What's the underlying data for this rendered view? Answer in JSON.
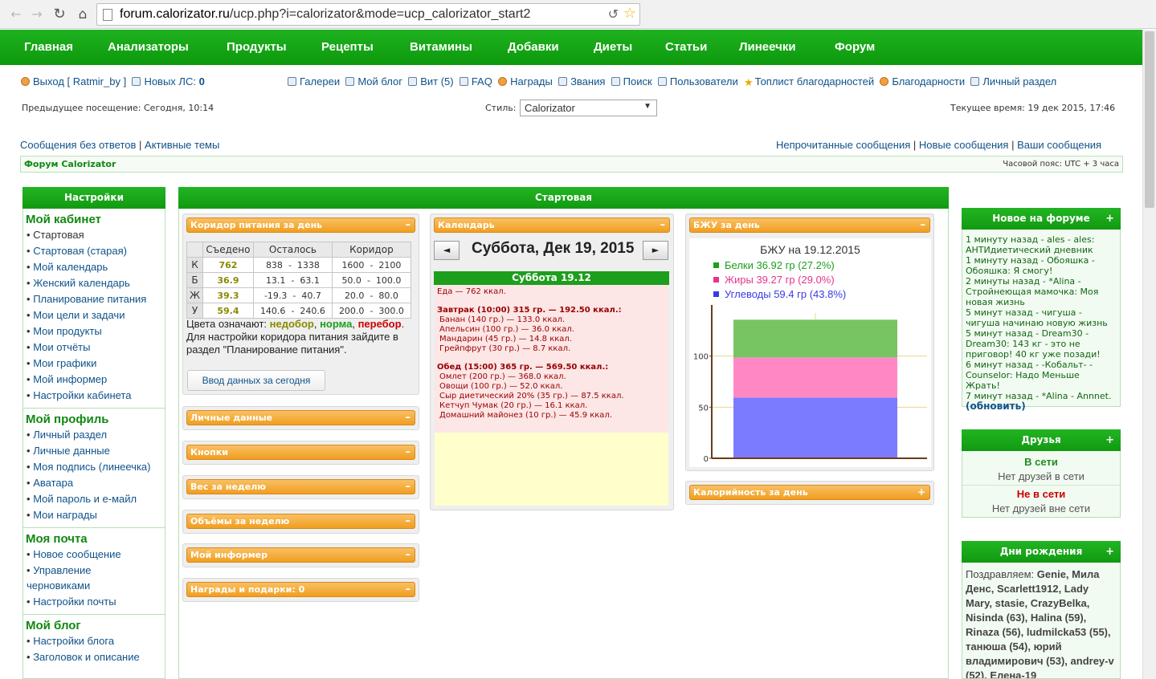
{
  "browser": {
    "url_host": "forum.calorizator.ru",
    "url_path": "/ucp.php?i=calorizator&mode=ucp_calorizator_start2"
  },
  "menu": [
    "Главная",
    "Анализаторы",
    "Продукты",
    "Рецепты",
    "Витамины",
    "Добавки",
    "Диеты",
    "Статьи",
    "Линеечки",
    "Форум"
  ],
  "user": {
    "logout": "Выход [ Ratmir_by ]",
    "new_pm_label": "Новых ЛС:",
    "new_pm_count": "0"
  },
  "toplinks": [
    "Галереи",
    "Мой блог",
    "Вит (5)",
    "FAQ",
    "Награды",
    "Звания",
    "Поиск",
    "Пользователи",
    "Топлист благодарностей",
    "Благодарности",
    "Личный раздел"
  ],
  "info": {
    "last_visit": "Предыдущее посещение: Сегодня, 10:14",
    "style_label": "Стиль:",
    "style_value": "Calorizator",
    "current_time": "Текущее время: 19 дек 2015, 17:46"
  },
  "subnav": {
    "no_answers": "Сообщения без ответов",
    "active": "Активные темы",
    "unread": "Непрочитанные сообщения",
    "new": "Новые сообщения",
    "yours": "Ваши сообщения",
    "separator": "|"
  },
  "forumbar": {
    "title": "Форум Calorizator",
    "timezone": "Часовой пояс: UTC + 3 часа"
  },
  "left": {
    "header": "Настройки",
    "sections": [
      {
        "title": "Мой кабинет",
        "items": [
          "Стартовая",
          "Стартовая (старая)",
          "Мой календарь",
          "Женский календарь",
          "Планирование питания",
          "Мои цели и задачи",
          "Мои продукты",
          "Мои отчёты",
          "Мои графики",
          "Мой информер",
          "Настройки кабинета"
        ]
      },
      {
        "title": "Мой профиль",
        "items": [
          "Личный раздел",
          "Личные данные",
          "Моя подпись (линеечка)",
          "Аватара",
          "Мой пароль и е-майл",
          "Мои награды"
        ]
      },
      {
        "title": "Моя почта",
        "items": [
          "Новое сообщение",
          "Управление",
          "черновиками",
          "Настройки почты"
        ]
      },
      {
        "title": "Мой блог",
        "items": [
          "Настройки блога",
          "Заголовок и описание"
        ]
      }
    ]
  },
  "center": {
    "header": "Стартовая",
    "corridor": {
      "title": "Коридор питания за день",
      "headers": [
        "",
        "Съедено",
        "Осталось",
        "Коридор"
      ],
      "rows": [
        {
          "label": "К",
          "eaten": "762",
          "rem_from": "838",
          "rem_to": "1338",
          "cor_from": "1600",
          "cor_to": "2100"
        },
        {
          "label": "Б",
          "eaten": "36.9",
          "rem_from": "13.1",
          "rem_to": "63.1",
          "cor_from": "50.0",
          "cor_to": "100.0"
        },
        {
          "label": "Ж",
          "eaten": "39.3",
          "rem_from": "-19.3",
          "rem_to": "40.7",
          "cor_from": "20.0",
          "cor_to": "80.0"
        },
        {
          "label": "У",
          "eaten": "59.4",
          "rem_from": "140.6",
          "rem_to": "240.6",
          "cor_from": "200.0",
          "cor_to": "300.0"
        }
      ],
      "dash": "-",
      "legend_prefix": "Цвета означают:",
      "legend_under": "недобор",
      "legend_norm": "норма",
      "legend_over": "перебор",
      "hint": "Для настройки коридора питания зайдите в раздел \"Планирование питания\".",
      "button": "Ввод данных за сегодня"
    },
    "collapsed": [
      "Личные данные",
      "Кнопки",
      "Вес за неделю",
      "Объёмы за неделю",
      "Мой информер",
      "Награды и подарки: 0"
    ],
    "minus": "–",
    "plus": "+",
    "calendar": {
      "title": "Календарь",
      "prev": "◄",
      "next": "►",
      "date": "Суббота, Дек 19, 2015",
      "daybar": "Суббота 19.12",
      "food_total": "Еда — 762 ккал.",
      "meals": [
        {
          "title": "Завтрак (10:00) 315 гр. — 192.50 ккал.:",
          "items": [
            "Банан (140 гр.) — 133.0 ккал.",
            "Апельсин (100 гр.) — 36.0 ккал.",
            "Мандарин (45 гр.) — 14.8 ккал.",
            "Грейпфрут (30 гр.) — 8.7 ккал."
          ]
        },
        {
          "title": "Обед (15:00) 365 гр. — 569.50 ккал.:",
          "items": [
            "Омлет (200 гр.) — 368.0 ккал.",
            "Овощи (100 гр.) — 52.0 ккал.",
            "Сыр диетический 20% (35 гр.) — 87.5 ккал.",
            "Кетчуп Чумак (20 гр.) — 16.1 ккал.",
            "Домашний майонез (10 гр.) — 45.9 ккал."
          ]
        }
      ]
    },
    "bzu": {
      "title": "БЖУ за день",
      "calories_title": "Калорийность за день"
    }
  },
  "chart_data": {
    "type": "bar",
    "title": "БЖУ на 19.12.2015",
    "stacked": true,
    "categories": [
      ""
    ],
    "series": [
      {
        "name": "Углеводы 59.4 гр (43.8%)",
        "values": [
          59.4
        ],
        "color": "#7b7bff"
      },
      {
        "name": "Жиры 39.27 гр (29.0%)",
        "values": [
          39.27
        ],
        "color": "#ff88c4"
      },
      {
        "name": "Белки 36.92 гр (27.2%)",
        "values": [
          36.92
        ],
        "color": "#77c462"
      }
    ],
    "legend_order": [
      "Белки 36.92 гр (27.2%)",
      "Жиры 39.27 гр (29.0%)",
      "Углеводы 59.4 гр (43.8%)"
    ],
    "legend_colors": [
      "#1d9e1d",
      "#e6338f",
      "#3a3ae6"
    ],
    "yticks": [
      "0",
      "50",
      "100"
    ],
    "ylim": [
      0,
      150
    ],
    "legend": "top"
  },
  "right": {
    "news": {
      "header": "Новое на форуме",
      "entries": [
        "1 минуту назад - ales - ales: АНТИдиетический дневник",
        "1 минуту назад - Обояшка - Обояшка: Я смогу!",
        "2 минуты назад - *Alina - Стройнеющая мамочка: Моя новая жизнь",
        "5 минут назад - чигуша - чигуша начинаю новую жизнь",
        "5 минут назад - Dream30 - Dream30: 143 кг - это не приговор! 40 кг уже позади!",
        "6 минут назад - -Кобальт- - Counselor: Надо Меньше Жрать!",
        "7 минут назад - *Alina - Annnet."
      ],
      "refresh": "(обновить)"
    },
    "friends": {
      "header": "Друзья",
      "online": "В сети",
      "online_none": "Нет друзей в сети",
      "offline": "Не в сети",
      "offline_none": "Нет друзей вне сети"
    },
    "birthdays": {
      "header": "Дни рождения",
      "prefix": "Поздравляем:",
      "names": "Genie, Мила Денс, Scarlett1912, Lady Mary, stasie, CrazyBelka, Nisinda (63), Halina (59), Rinaza (56), ludmilcka53 (55), танюша (54), юрий владимирович (53), andrey-v (52), Елена-19"
    }
  }
}
